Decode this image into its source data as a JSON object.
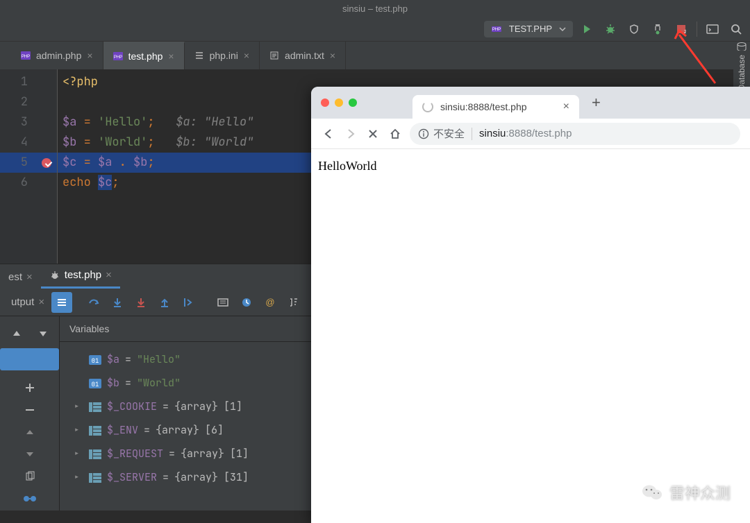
{
  "window": {
    "title": "sinsiu – test.php"
  },
  "runConfig": {
    "label": "TEST.PHP"
  },
  "editorTabs": [
    {
      "name": "admin.php",
      "type": "php",
      "active": false
    },
    {
      "name": "test.php",
      "type": "php",
      "active": true
    },
    {
      "name": "php.ini",
      "type": "ini",
      "active": false
    },
    {
      "name": "admin.txt",
      "type": "txt",
      "active": false
    }
  ],
  "code": {
    "lines": [
      {
        "n": 1,
        "segments": [
          [
            "tag",
            "<?php"
          ]
        ]
      },
      {
        "n": 2,
        "segments": []
      },
      {
        "n": 3,
        "segments": [
          [
            "var",
            "$a"
          ],
          [
            "plain",
            " "
          ],
          [
            "op",
            "="
          ],
          [
            "plain",
            " "
          ],
          [
            "str",
            "'Hello'"
          ],
          [
            "punc",
            ";"
          ],
          [
            "plain",
            "   "
          ],
          [
            "cmt",
            "$a: \"Hello\""
          ]
        ]
      },
      {
        "n": 4,
        "segments": [
          [
            "var",
            "$b"
          ],
          [
            "plain",
            " "
          ],
          [
            "op",
            "="
          ],
          [
            "plain",
            " "
          ],
          [
            "str",
            "'World'"
          ],
          [
            "punc",
            ";"
          ],
          [
            "plain",
            "   "
          ],
          [
            "cmt",
            "$b: \"World\""
          ]
        ]
      },
      {
        "n": 5,
        "hl": true,
        "bp": true,
        "segments": [
          [
            "var",
            "$c"
          ],
          [
            "plain",
            " "
          ],
          [
            "op",
            "="
          ],
          [
            "plain",
            " "
          ],
          [
            "var",
            "$a"
          ],
          [
            "plain",
            " "
          ],
          [
            "op",
            "."
          ],
          [
            "plain",
            " "
          ],
          [
            "var",
            "$b"
          ],
          [
            "punc",
            ";"
          ]
        ]
      },
      {
        "n": 6,
        "segments": [
          [
            "kw",
            "echo"
          ],
          [
            "plain",
            " "
          ],
          [
            "varsel",
            "$c"
          ],
          [
            "punc",
            ";"
          ]
        ]
      }
    ]
  },
  "debugTabs": {
    "left": {
      "name": "est"
    },
    "active": {
      "name": "test.php"
    }
  },
  "outputTab": {
    "label": "utput"
  },
  "variables": {
    "header": "Variables",
    "items": [
      {
        "kind": "scalar",
        "name": "$a",
        "value": "\"Hello\""
      },
      {
        "kind": "scalar",
        "name": "$b",
        "value": "\"World\""
      },
      {
        "kind": "array",
        "name": "$_COOKIE",
        "type": "{array}",
        "count": "[1]"
      },
      {
        "kind": "array",
        "name": "$_ENV",
        "type": "{array}",
        "count": "[6]"
      },
      {
        "kind": "array",
        "name": "$_REQUEST",
        "type": "{array}",
        "count": "[1]"
      },
      {
        "kind": "array",
        "name": "$_SERVER",
        "type": "{array}",
        "count": "[31]"
      }
    ]
  },
  "browser": {
    "tabTitle": "sinsiu:8888/test.php",
    "insecureLabel": "不安全",
    "urlHost": "sinsiu",
    "urlRest": ":8888/test.php",
    "pageText": "HelloWorld"
  },
  "rightRail": {
    "label": "Database"
  },
  "watermark": {
    "text": "雷神众测"
  }
}
